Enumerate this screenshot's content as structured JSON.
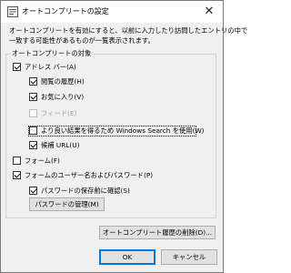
{
  "window": {
    "title": "オートコンプリートの設定",
    "close_glyph": "✕"
  },
  "description": {
    "line1": "オートコンプリートを有効にすると、以前に入力したり訪問したエントリの中で",
    "line2": "一致する可能性があるものが一覧表示されます。"
  },
  "group": {
    "label": "オートコンプリートの対象",
    "items": [
      {
        "label": "アドレス バー(A)",
        "checked": true,
        "disabled": false
      },
      {
        "label": "閲覧の履歴(H)",
        "checked": true,
        "disabled": false
      },
      {
        "label": "お気に入り(V)",
        "checked": true,
        "disabled": false
      },
      {
        "label": "フィード(E)",
        "checked": false,
        "disabled": true
      },
      {
        "label": "より良い結果を得るため Windows Search を使用(W)",
        "checked": false,
        "disabled": false
      },
      {
        "label": "候補 URL(U)",
        "checked": true,
        "disabled": false
      },
      {
        "label": "フォーム(F)",
        "checked": false,
        "disabled": false
      },
      {
        "label": "フォームのユーザー名およびパスワード(P)",
        "checked": true,
        "disabled": false
      },
      {
        "label": "パスワードの保存前に確認(S)",
        "checked": true,
        "disabled": false
      }
    ],
    "manage_passwords_button": "パスワードの管理(M)"
  },
  "buttons": {
    "delete_history": "オートコンプリート履歴の削除(D)...",
    "ok": "OK",
    "cancel": "キャンセル"
  },
  "colors": {
    "focus_border": "#0078d7",
    "button_face": "#e1e1e1",
    "dialog_bg": "#f0f0f0"
  }
}
